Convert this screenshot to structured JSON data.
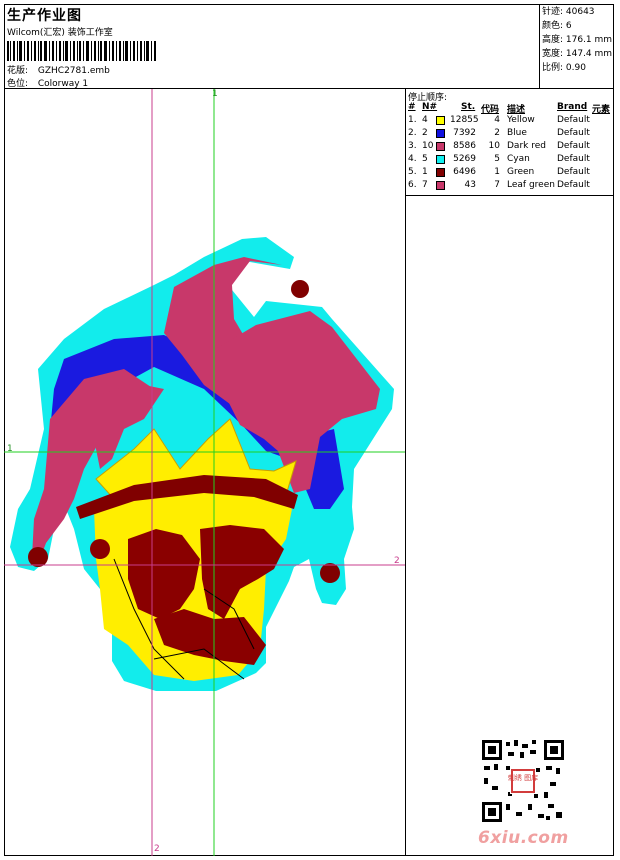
{
  "header": {
    "title": "生产作业图",
    "company": "Wilcom(汇宏) 装饰工作室",
    "design_label": "花版:",
    "design_value": "GZHC2781.emb",
    "colorway_label": "色位:",
    "colorway_value": "Colorway 1"
  },
  "stats": {
    "stitches": "针迹: 40643",
    "colors": "颜色: 6",
    "height": "高度: 176.1 mm",
    "width": "宽度: 147.4 mm",
    "scale": "比例: 0.90"
  },
  "stop_sequence": {
    "title": "停止顺序:",
    "headers": {
      "index": "#",
      "needle": "N#",
      "stitches": "St.",
      "code": "代码",
      "desc": "描述",
      "brand": "Brand",
      "element": "元素"
    },
    "rows": [
      {
        "index": "1.",
        "needle": "4",
        "color": "#ffff00",
        "stitches": "12855",
        "code": "4",
        "desc": "Yellow",
        "brand": "Default"
      },
      {
        "index": "2.",
        "needle": "2",
        "color": "#1010e0",
        "stitches": "7392",
        "code": "2",
        "desc": "Blue",
        "brand": "Default"
      },
      {
        "index": "3.",
        "needle": "10",
        "color": "#c8386a",
        "stitches": "8586",
        "code": "10",
        "desc": "Dark red",
        "brand": "Default"
      },
      {
        "index": "4.",
        "needle": "5",
        "color": "#10f0f0",
        "stitches": "5269",
        "code": "5",
        "desc": "Cyan",
        "brand": "Default"
      },
      {
        "index": "5.",
        "needle": "1",
        "color": "#800000",
        "stitches": "6496",
        "code": "1",
        "desc": "Green",
        "brand": "Default"
      },
      {
        "index": "6.",
        "needle": "7",
        "color": "#c8386a",
        "stitches": "43",
        "code": "7",
        "desc": "Leaf green",
        "brand": "Default"
      }
    ]
  },
  "guides": {
    "vertical_top": "1",
    "horizontal_left": "1",
    "horizontal_right": "2",
    "vertical_bottom": "2"
  },
  "watermark": {
    "qr_seal": "刺绣 图库",
    "site": "6xiu.com"
  }
}
